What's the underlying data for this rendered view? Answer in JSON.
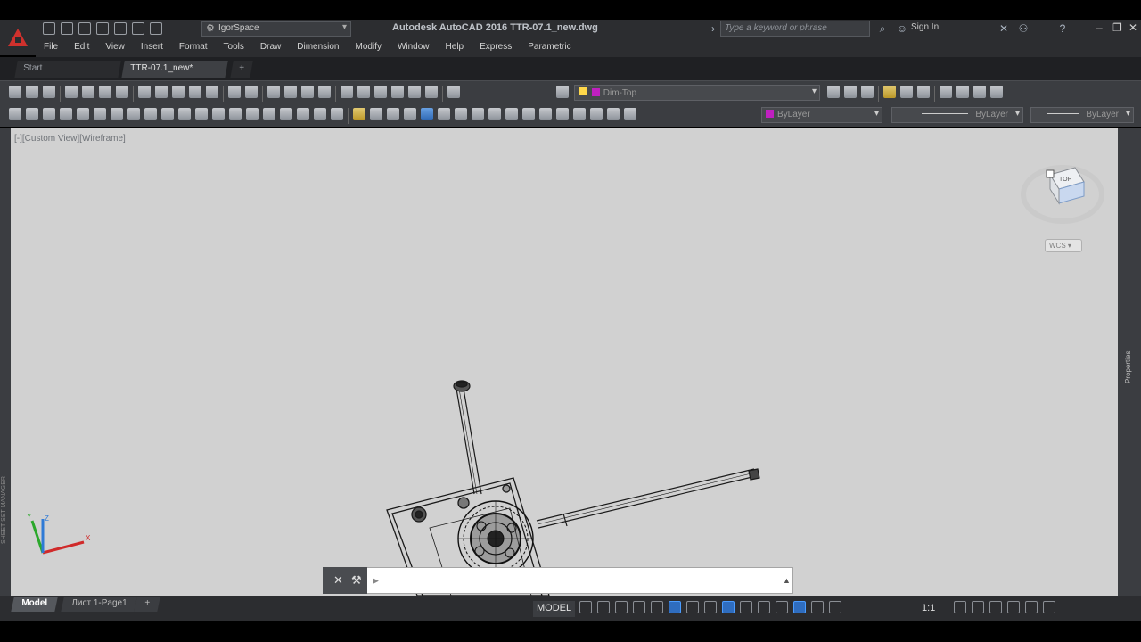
{
  "app": {
    "title": "Autodesk AutoCAD 2016    TTR-07.1_new.dwg",
    "workspace": "IgorSpace",
    "search_placeholder": "Type a keyword or phrase",
    "sign_in": "Sign In"
  },
  "menu": [
    "File",
    "Edit",
    "View",
    "Insert",
    "Format",
    "Tools",
    "Draw",
    "Dimension",
    "Modify",
    "Window",
    "Help",
    "Express",
    "Parametric"
  ],
  "doc_tabs": [
    "Start",
    "TTR-07.1_new*"
  ],
  "new_tab_label": "+",
  "ribbon": {
    "layer": "Dim-Top",
    "color": "ByLayer",
    "linetype": "ByLayer",
    "lineweight": "ByLayer"
  },
  "viewport": {
    "view_controls": "[-][Custom View][Wireframe]",
    "viewcube_face": "TOP",
    "wcs_label": "WCS",
    "side_panel": "Properties",
    "left_panel": "SHEET SET MANAGER"
  },
  "command": {
    "prompt": "▶ "
  },
  "status": {
    "layout_tabs": [
      "Model",
      "Лист 1-Page1"
    ],
    "add_layout": "+",
    "model_label": "MODEL",
    "scale": "1:1"
  },
  "colors": {
    "accent": "#2f6dbf",
    "viewport_bg": "#d1d1d1",
    "layer_color": "#c020c0"
  }
}
